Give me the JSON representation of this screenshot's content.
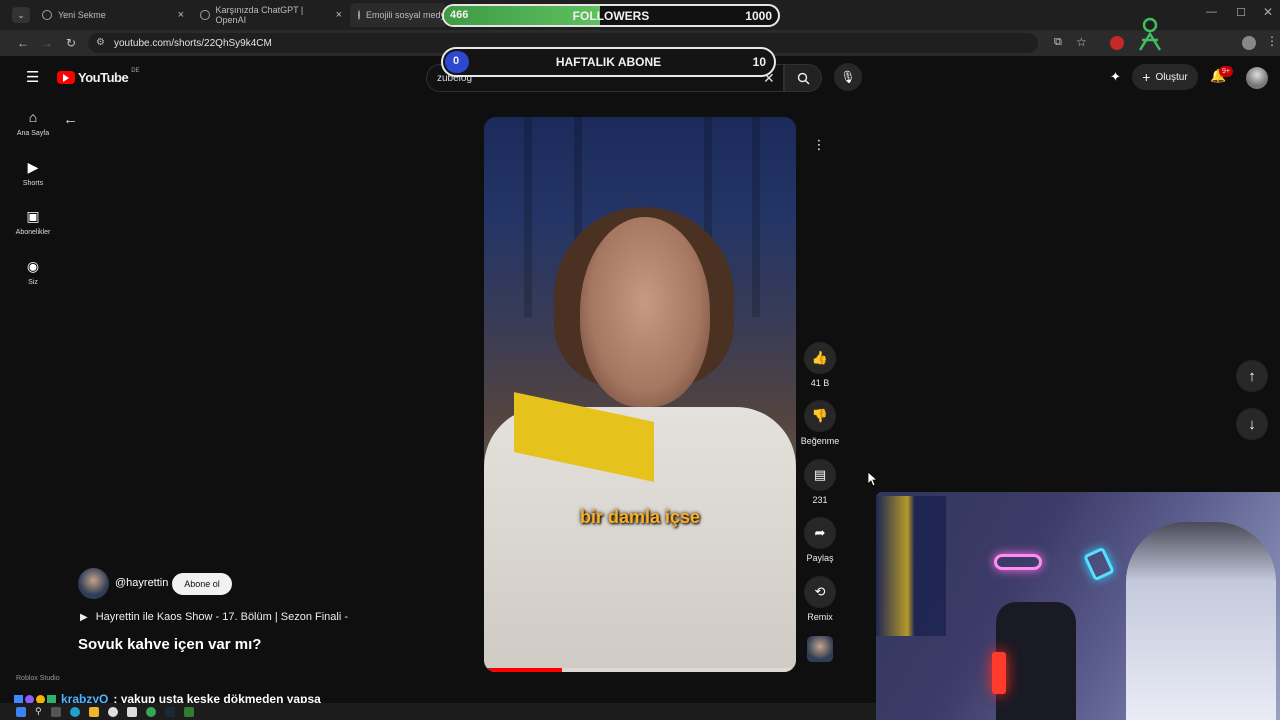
{
  "browser": {
    "tabs": [
      {
        "title": "Yeni Sekme",
        "active": false
      },
      {
        "title": "Karşınızda ChatGPT | OpenAI",
        "active": false
      },
      {
        "title": "Emojili sosyal medya",
        "active": true
      }
    ],
    "url": "youtube.com/shorts/22QhSy9k4CM"
  },
  "youtube": {
    "logo_text": "YouTube",
    "region": "DE",
    "search_value": "zubelög",
    "create_label": "Oluştur",
    "notification_badge": "9+",
    "sidebar": [
      {
        "label": "Ana Sayfa",
        "icon": "home-icon"
      },
      {
        "label": "Shorts",
        "icon": "shorts-icon"
      },
      {
        "label": "Abonelikler",
        "icon": "subscriptions-icon"
      },
      {
        "label": "Siz",
        "icon": "you-icon"
      }
    ]
  },
  "short": {
    "caption": "bir damla içse",
    "channel": "@hayrettin",
    "subscribe_label": "Abone ol",
    "playlist": "Hayrettin ile Kaos Show - 17. Bölüm | Sezon Finali -",
    "title": "Sovuk kahve içen var mı?",
    "progress": 0.25,
    "actions": {
      "like_count": "41 B",
      "dislike_label": "Beğenme",
      "comment_count": "231",
      "share_label": "Paylaş",
      "remix_label": "Remix"
    }
  },
  "overlay": {
    "followers": {
      "current": "466",
      "label": "FOLLOWERS",
      "goal": "1000",
      "fill": 0.466
    },
    "weekly": {
      "current": "0",
      "label": "HAFTALIK ABONE",
      "goal": "10"
    }
  },
  "chat": {
    "user": "krabzyQ",
    "message": ": yakup usta keşke dökmeden yapsa",
    "user_color": "#4fb3ff"
  },
  "taskbar_label": "Roblox Studio",
  "colors": {
    "youtube_red": "#ff0000",
    "followers_green": "#4caf50",
    "weekly_blue": "#2d47d0"
  }
}
